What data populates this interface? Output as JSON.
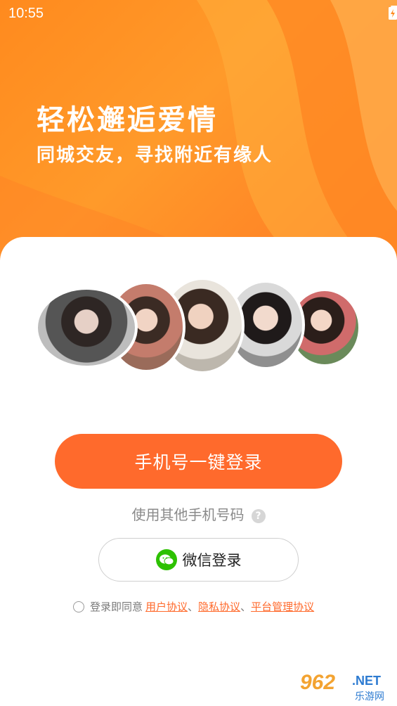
{
  "status_bar": {
    "time": "10:55",
    "icons": [
      "wifi-icon",
      "signal-icon",
      "battery-icon"
    ]
  },
  "hero": {
    "title": "轻松邂逅爱情",
    "subtitle": "同城交友，寻找附近有缘人"
  },
  "primary_login": {
    "label": "手机号一键登录"
  },
  "other_phone": {
    "label": "使用其他手机号码",
    "help": "?"
  },
  "wechat_login": {
    "label": "微信登录",
    "icon": "wechat-icon"
  },
  "agreement": {
    "prefix": "登录即同意",
    "user_agreement": "用户协议",
    "sep1": "、",
    "privacy": "隐私协议",
    "sep2": "、",
    "platform": "平台管理协议"
  },
  "watermark": {
    "big": "962",
    "net": ".NET",
    "small": "乐游网"
  },
  "colors": {
    "accent": "#ff6a2c",
    "hero": "#ff8a1e",
    "wechat": "#2dc100"
  }
}
